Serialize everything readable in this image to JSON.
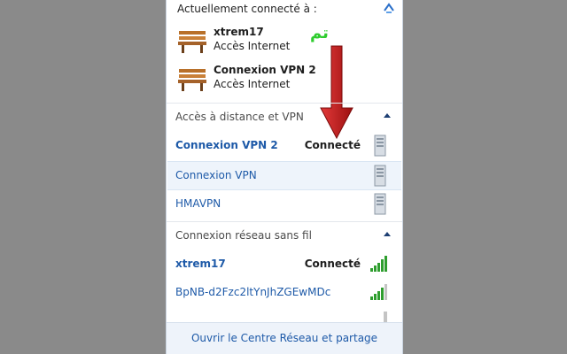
{
  "header": {
    "title": "Actuellement connecté à :"
  },
  "current_connections": [
    {
      "name": "xtrem17",
      "status": "Accès Internet"
    },
    {
      "name": "Connexion VPN 2",
      "status": "Accès Internet"
    }
  ],
  "overlay": {
    "annotation_text": "تم",
    "annotation_color": "#2ecc2e",
    "arrow_color": "#c01818"
  },
  "vpn_section": {
    "title": "Accès à distance et VPN",
    "items": [
      {
        "name": "Connexion VPN 2",
        "status": "Connecté",
        "icon": "server-icon"
      },
      {
        "name": "Connexion VPN",
        "status": "",
        "icon": "server-icon"
      },
      {
        "name": "HMAVPN",
        "status": "",
        "icon": "server-icon"
      }
    ]
  },
  "wifi_section": {
    "title": "Connexion réseau sans fil",
    "items": [
      {
        "name": "xtrem17",
        "status": "Connecté",
        "icon": "signal-icon"
      },
      {
        "name": "BpNB-d2Fzc2ltYnJhZGEwMDc",
        "status": "",
        "icon": "signal-icon"
      }
    ]
  },
  "footer": {
    "link": "Ouvrir le Centre Réseau et partage"
  },
  "colors": {
    "link": "#1e5aa8",
    "footer_bg": "#eef3fa",
    "highlight": "#eef4fb"
  }
}
